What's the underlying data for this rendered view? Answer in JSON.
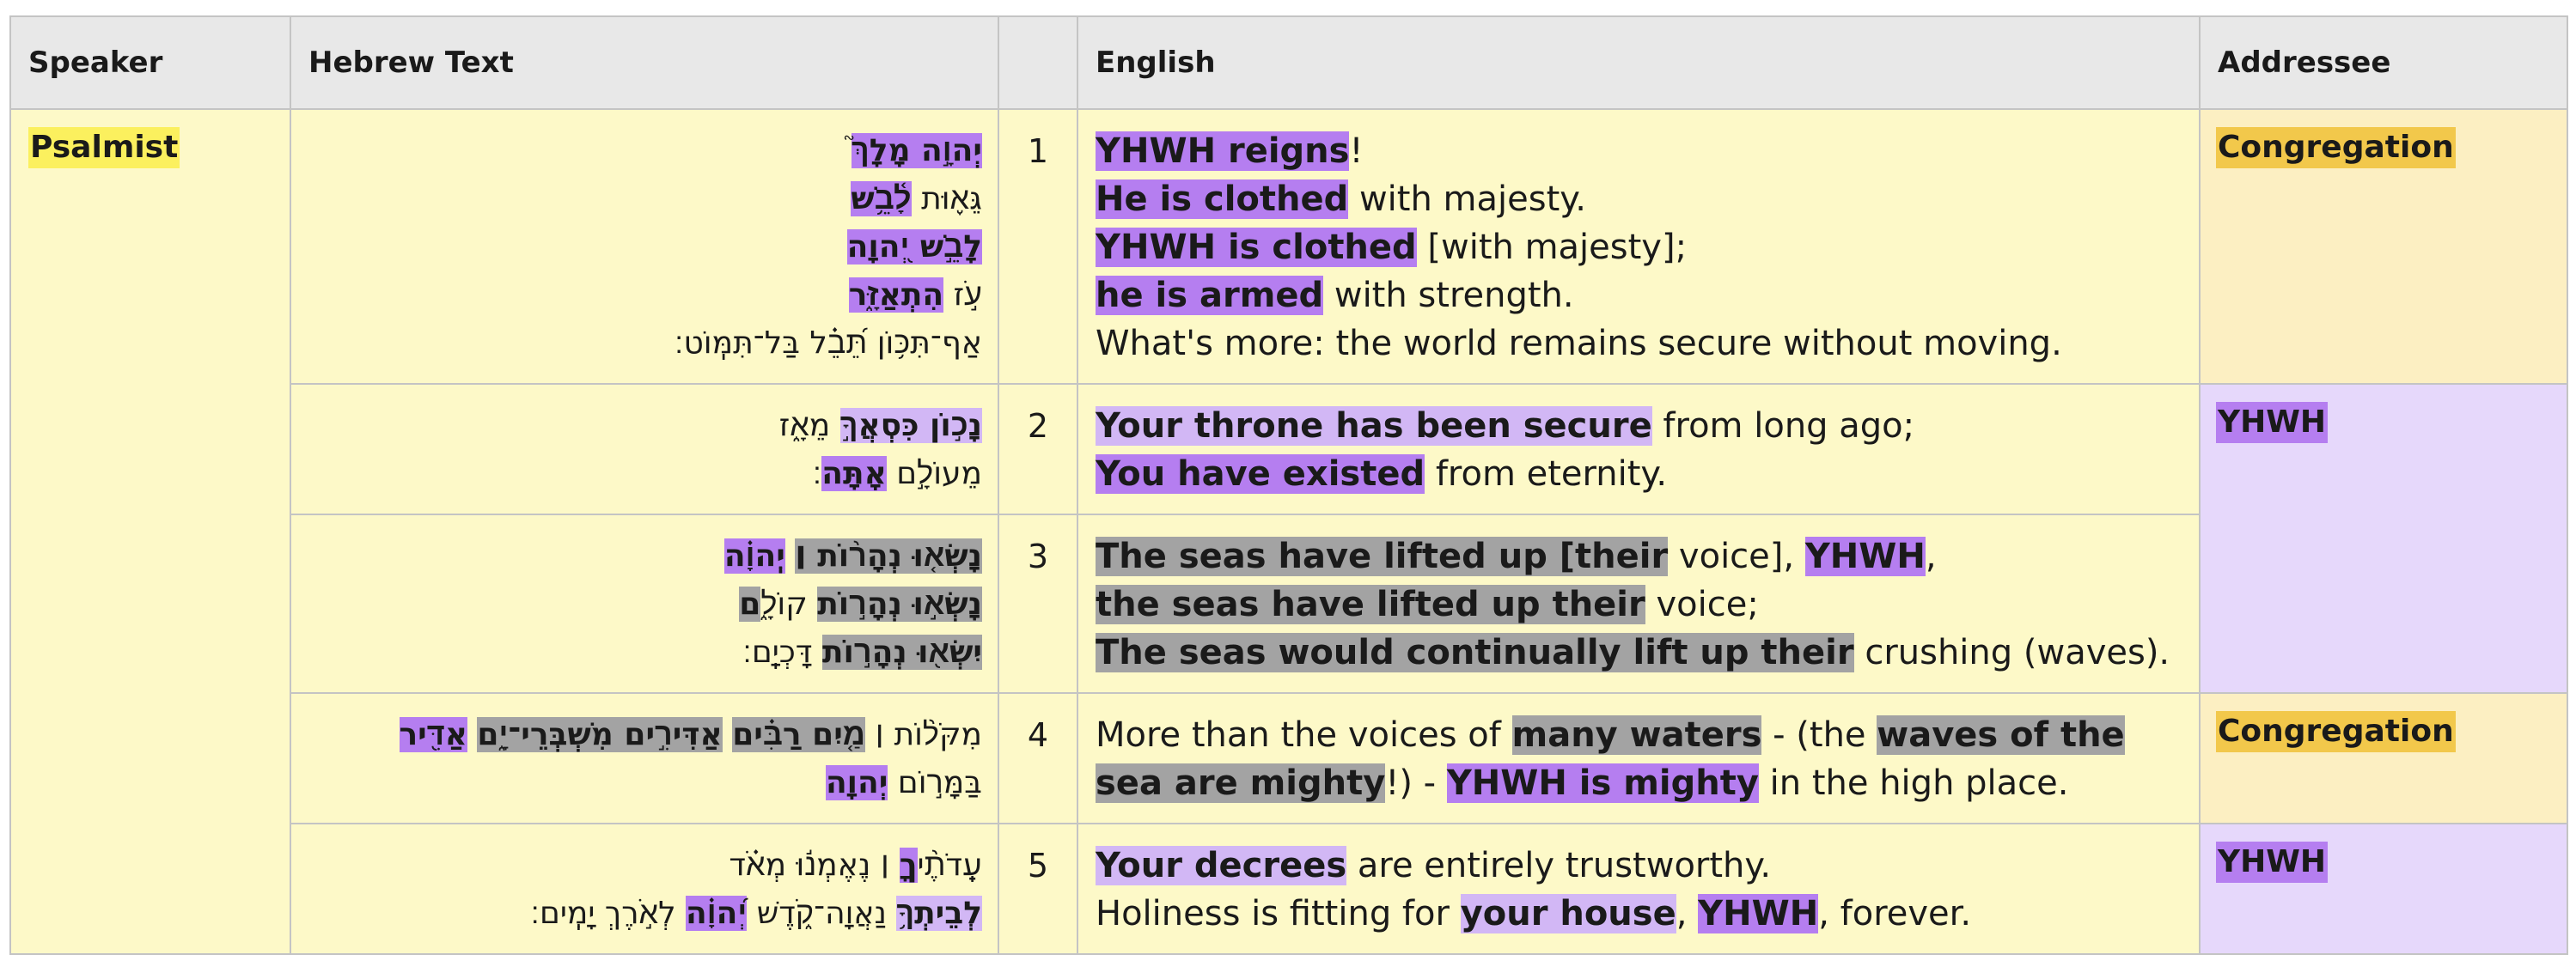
{
  "headers": {
    "speaker": "Speaker",
    "hebrew": "Hebrew Text",
    "num": "",
    "english": "English",
    "addressee": "Addressee"
  },
  "speaker": "Psalmist",
  "addressees": {
    "a1": "Congregation",
    "a2": "YHWH",
    "a4": "Congregation",
    "a5": "YHWH"
  },
  "colors": {
    "purple": "#b57ef0",
    "light_purple": "#d2b7f5",
    "gray": "#a3a3a3",
    "yellow_bg": "#fdf9c8",
    "congregation_tag": "#f2c84b",
    "psalmist_tag": "#fbf05e",
    "yhwh_cell_bg": "#e6d8fb",
    "congregation_cell_bg": "#fcefc2"
  },
  "rows": [
    {
      "num": "1",
      "hebrew": [
        [
          {
            "t": "יְהוָ֣ה מָלָךְ֮",
            "h": "p"
          }
        ],
        [
          {
            "t": "גֵּא֪וּת ",
            "h": ""
          },
          {
            "t": "לָ֫בֵ֥שׁ",
            "h": "p"
          }
        ],
        [
          {
            "t": "לָבֵ֣שׁ יְ֭הוָה",
            "h": "p"
          }
        ],
        [
          {
            "t": "עֹ֣ז ",
            "h": ""
          },
          {
            "t": "הִתְאַזָּ֑ר",
            "h": "p"
          }
        ],
        [
          {
            "t": "אַף־תִּכּ֥וֹן תֵּ֝בֵ֗ל בַּל־תִּמּֽוֹט׃",
            "h": ""
          }
        ]
      ],
      "english": [
        [
          {
            "t": "YHWH reigns",
            "h": "p"
          },
          {
            "t": "!",
            "h": ""
          }
        ],
        [
          {
            "t": "He is clothed",
            "h": "p"
          },
          {
            "t": " with majesty.",
            "h": ""
          }
        ],
        [
          {
            "t": "YHWH is clothed",
            "h": "p"
          },
          {
            "t": " [with majesty];",
            "h": ""
          }
        ],
        [
          {
            "t": "he is armed",
            "h": "p"
          },
          {
            "t": " with strength.",
            "h": ""
          }
        ],
        [
          {
            "t": "What's more: the world remains secure without moving.",
            "h": ""
          }
        ]
      ]
    },
    {
      "num": "2",
      "hebrew": [
        [
          {
            "t": "נָכ֣וֹן כִּסְאֲךָ֣",
            "h": "lp"
          },
          {
            "t": " מֵאָ֑ז",
            "h": ""
          }
        ],
        [
          {
            "t": "מֵעוֹלָ֣ם ",
            "h": ""
          },
          {
            "t": "אָֽתָּה",
            "h": "p"
          },
          {
            "t": "׃",
            "h": ""
          }
        ]
      ],
      "english": [
        [
          {
            "t": "Your throne has been secure",
            "h": "lp"
          },
          {
            "t": " from long ago;",
            "h": ""
          }
        ],
        [
          {
            "t": "You have existed",
            "h": "p"
          },
          {
            "t": " from eternity.",
            "h": ""
          }
        ]
      ]
    },
    {
      "num": "3",
      "hebrew": [
        [
          {
            "t": "נָשְׂא֤וּ נְהָר֨וֹת ׀",
            "h": "g"
          },
          {
            "t": " ",
            "h": ""
          },
          {
            "t": "יְֽהוָ֗ה",
            "h": "p"
          }
        ],
        [
          {
            "t": "נָשְׂא֣וּ נְהָר֣וֹת",
            "h": "g"
          },
          {
            "t": " קוֹלָ֑",
            "h": ""
          },
          {
            "t": "ם",
            "h": "g"
          }
        ],
        [
          {
            "t": "יִשְׂא֖וּ נְהָר֣וֹת",
            "h": "g"
          },
          {
            "t": " דָּכְיָֽם׃",
            "h": ""
          }
        ]
      ],
      "english": [
        [
          {
            "t": "The seas have lifted up [their",
            "h": "g"
          },
          {
            "t": " voice], ",
            "h": ""
          },
          {
            "t": "YHWH",
            "h": "p"
          },
          {
            "t": ",",
            "h": ""
          }
        ],
        [
          {
            "t": "the seas have lifted up their",
            "h": "g"
          },
          {
            "t": " voice;",
            "h": ""
          }
        ],
        [
          {
            "t": "The seas would continually lift up their",
            "h": "g"
          },
          {
            "t": " crushing (waves).",
            "h": ""
          }
        ]
      ]
    },
    {
      "num": "4",
      "hebrew": [
        [
          {
            "t": "מִקֹּל֨וֹת ׀ ",
            "h": ""
          },
          {
            "t": "מַ֤יִם רַבִּ֗ים",
            "h": "g"
          },
          {
            "t": " ",
            "h": ""
          },
          {
            "t": "אַדִּירִ֣ים מִשְׁבְּרֵי־יָ֑ם",
            "h": "g"
          },
          {
            "t": " ",
            "h": ""
          },
          {
            "t": "אַדִּ֖יר",
            "h": "p"
          }
        ],
        [
          {
            "t": "בַּמָּר֣וֹם ",
            "h": ""
          },
          {
            "t": "יְהוָֽה",
            "h": "p"
          }
        ]
      ],
      "english": [
        [
          {
            "t": "More than the voices of ",
            "h": ""
          },
          {
            "t": "many waters",
            "h": "g"
          },
          {
            "t": " - (the ",
            "h": ""
          },
          {
            "t": "waves of the sea are mighty",
            "h": "g"
          },
          {
            "t": "!) - ",
            "h": ""
          },
          {
            "t": "YHWH is mighty",
            "h": "p"
          },
          {
            "t": " in the high place.",
            "h": ""
          }
        ]
      ]
    },
    {
      "num": "5",
      "hebrew": [
        [
          {
            "t": "עֵֽדֹתֶ֨י",
            "h": ""
          },
          {
            "t": "ךָ",
            "h": "p"
          },
          {
            "t": " ׀ נֶאֶמְנ֬וּ מְאֹ֗ד",
            "h": ""
          }
        ],
        [
          {
            "t": "לְבֵיתְךָ֥",
            "h": "lp"
          },
          {
            "t": " נַאֲוָה־קֹ֑דֶשׁ ",
            "h": ""
          },
          {
            "t": "יְ֝הוָ֗ה",
            "h": "p"
          },
          {
            "t": " לְאֹ֣רֶךְ יָמִֽים׃",
            "h": ""
          }
        ]
      ],
      "english": [
        [
          {
            "t": "Your decrees",
            "h": "lp"
          },
          {
            "t": " are entirely trustworthy.",
            "h": ""
          }
        ],
        [
          {
            "t": "Holiness is fitting for ",
            "h": ""
          },
          {
            "t": "your house",
            "h": "lp"
          },
          {
            "t": ", ",
            "h": ""
          },
          {
            "t": "YHWH",
            "h": "p"
          },
          {
            "t": ", forever.",
            "h": ""
          }
        ]
      ]
    }
  ]
}
